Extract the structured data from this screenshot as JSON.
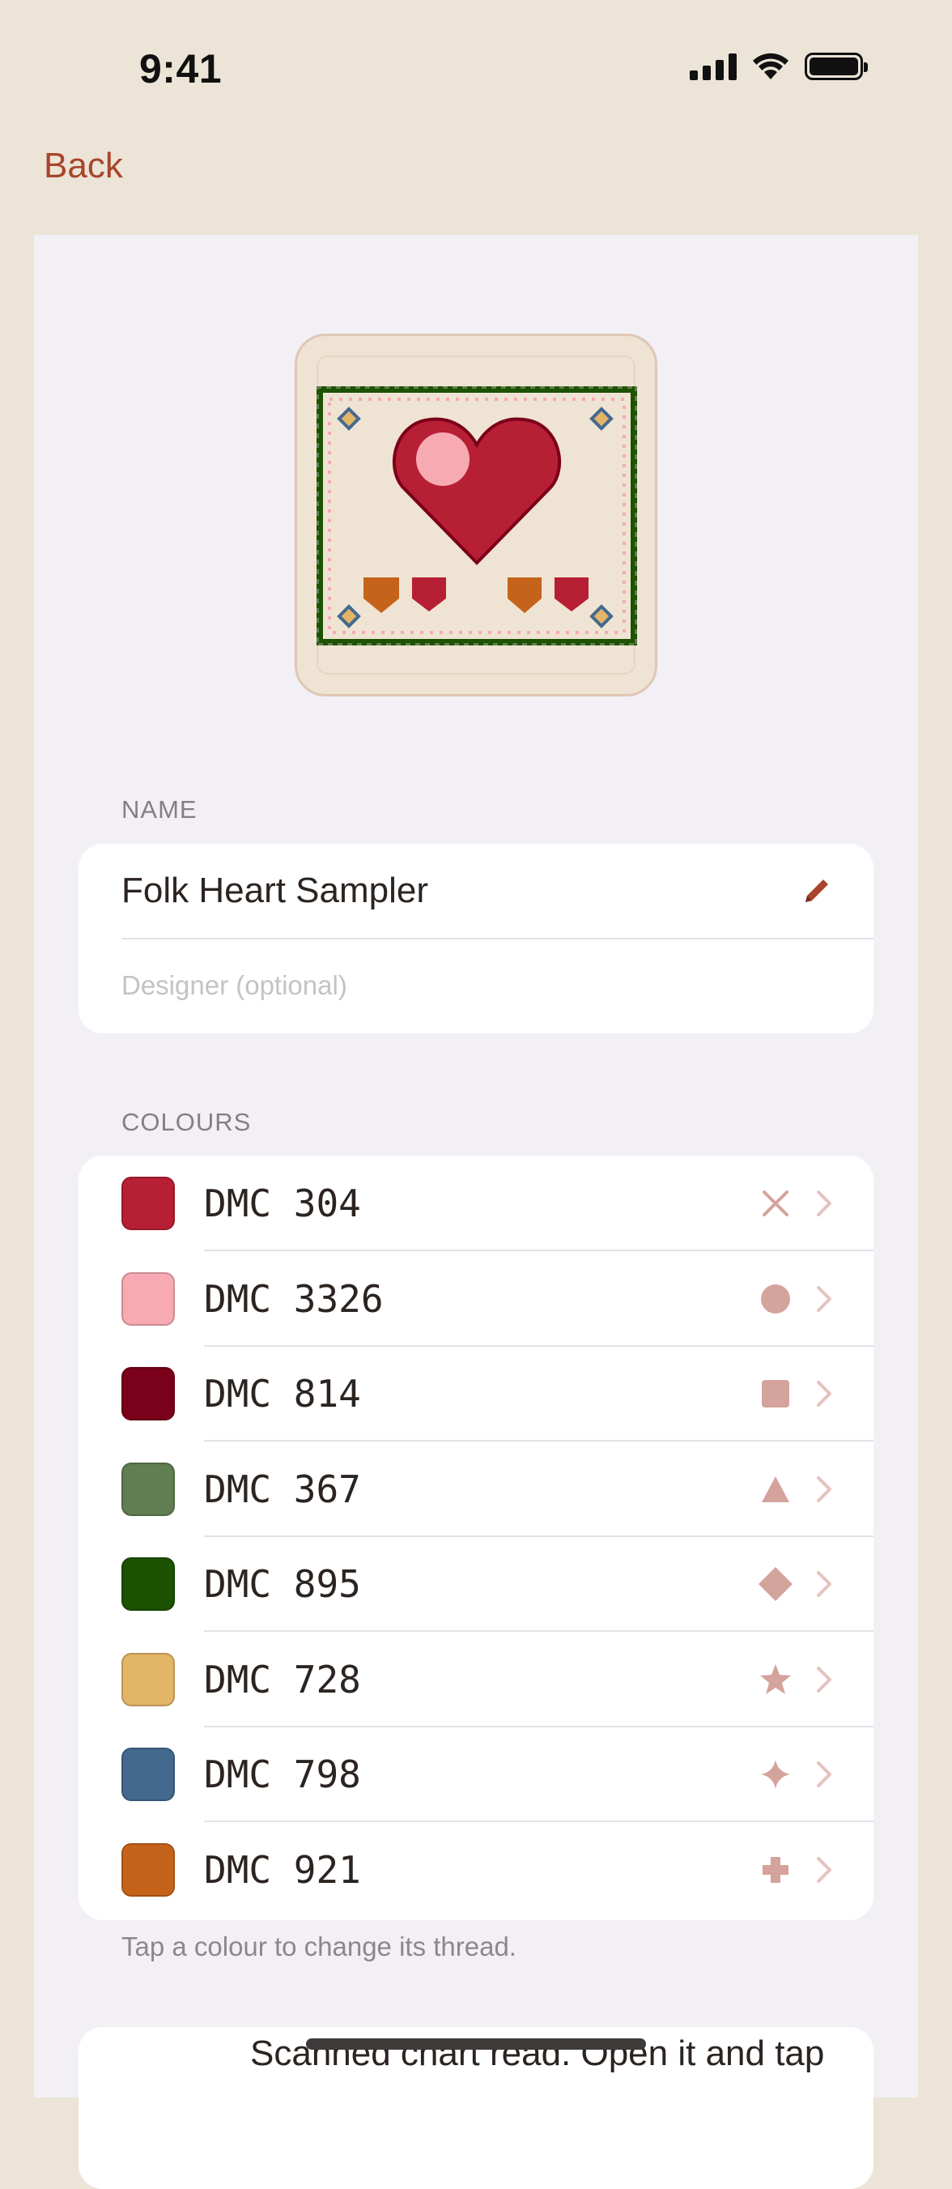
{
  "status_bar": {
    "time": "9:41"
  },
  "nav": {
    "back_label": "Back"
  },
  "name_section": {
    "header": "NAME",
    "name_value": "Folk Heart Sampler",
    "designer_placeholder": "Designer (optional)"
  },
  "colours_section": {
    "header": "COLOURS",
    "items": [
      {
        "label": "DMC 304",
        "color": "#b71f34",
        "symbol": "cross"
      },
      {
        "label": "DMC 3326",
        "color": "#f7aab2",
        "symbol": "circle"
      },
      {
        "label": "DMC 814",
        "color": "#7b001a",
        "symbol": "square"
      },
      {
        "label": "DMC 367",
        "color": "#617d52",
        "symbol": "triangle"
      },
      {
        "label": "DMC 895",
        "color": "#1c5200",
        "symbol": "diamond"
      },
      {
        "label": "DMC 728",
        "color": "#e3b567",
        "symbol": "star"
      },
      {
        "label": "DMC 798",
        "color": "#44698f",
        "symbol": "sparkle"
      },
      {
        "label": "DMC 921",
        "color": "#c6631b",
        "symbol": "plus"
      }
    ],
    "hint": "Tap a colour to change its thread."
  },
  "bottom_card": {
    "text": "Scanned chart read. Open it and tap"
  },
  "theme": {
    "accent": "#a8442c",
    "symbol_color": "#d4a39c",
    "chevron_color": "#e4c3bf"
  }
}
